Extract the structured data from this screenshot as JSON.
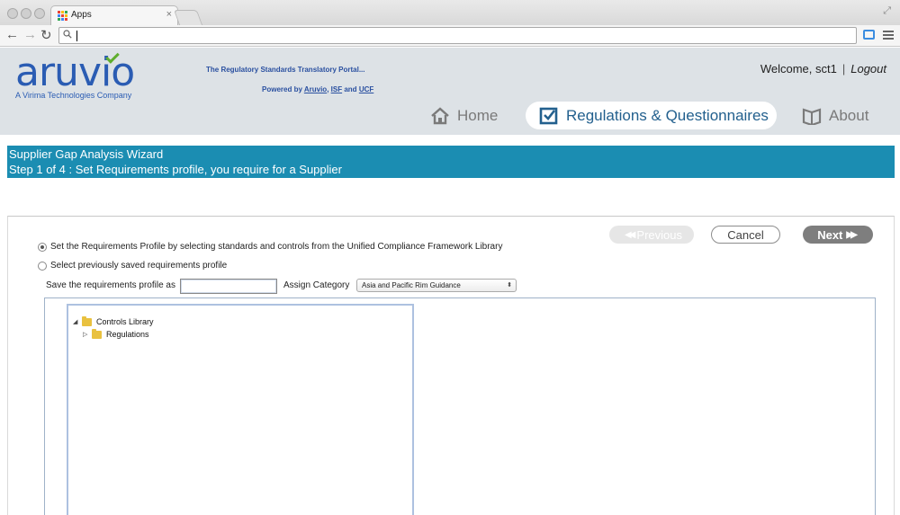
{
  "browser": {
    "tab_title": "Apps",
    "tab_close": "×",
    "address_value": ""
  },
  "header": {
    "logo_text": "aruvio",
    "logo_subtitle": "A Virima Technologies Company",
    "tagline": "The Regulatory Standards Translatory Portal...",
    "powered_by": {
      "prefix": "Powered by",
      "link1": "Aruvio",
      "sep1": ",",
      "link2": "ISF",
      "and": "and",
      "link3": "UCF"
    },
    "welcome": "Welcome, sct1",
    "separator": "|",
    "logout": "Logout"
  },
  "nav": {
    "home": "Home",
    "regulations": "Regulations & Questionnaires",
    "about": "About"
  },
  "wizard": {
    "title": "Supplier Gap Analysis Wizard",
    "step": "Step 1 of 4 : Set Requirements profile, you require for a Supplier"
  },
  "buttons": {
    "previous": "Previous",
    "cancel": "Cancel",
    "next": "Next"
  },
  "options": {
    "option1": "Set the Requirements Profile by selecting standards and controls from the Unified Compliance Framework Library",
    "option1_selected": true,
    "option2": "Select previously saved requirements profile",
    "option2_selected": false
  },
  "form": {
    "save_label": "Save the requirements profile as",
    "save_value": "",
    "category_label": "Assign Category",
    "category_value": "Asia and Pacific Rim Guidance"
  },
  "tree": {
    "root": "Controls Library",
    "child": "Regulations"
  },
  "colors": {
    "brand_blue": "#2a5cb3",
    "banner": "#1b8db2",
    "nav_active_text": "#23608e"
  }
}
